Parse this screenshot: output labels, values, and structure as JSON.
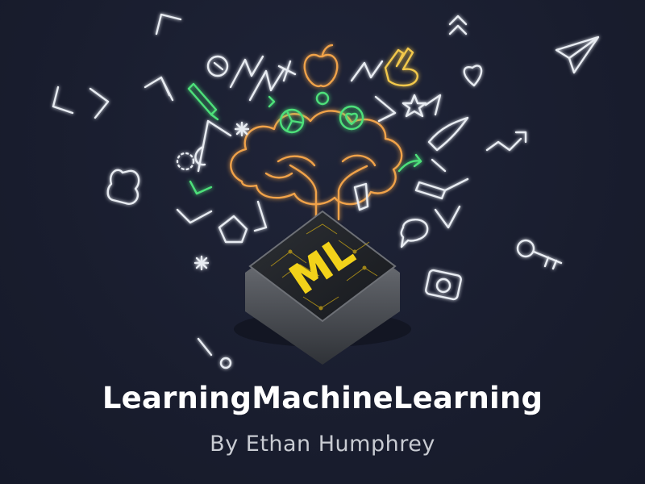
{
  "cover": {
    "title": "LearningMachineLearning",
    "byline": "By Ethan Humphrey",
    "badge_text": "ML"
  },
  "colors": {
    "background": "#191d2e",
    "neon_white": "#e8ecf2",
    "neon_green": "#4ee07a",
    "neon_yellow": "#f2c84b",
    "neon_orange": "#f0a24a",
    "chip_text": "#f2d21a",
    "chip_body": "#5a5d63",
    "title_text": "#ffffff",
    "byline_text": "#c8cbd2"
  },
  "icons": [
    "apple-logo-icon",
    "peace-hand-icon",
    "brain-tree-icon",
    "thumbs-up-hand-icon",
    "paper-plane-icon",
    "heart-icon",
    "key-icon",
    "camera-icon",
    "music-note-icon",
    "lightning-icon",
    "star-icon",
    "exclamation-icon",
    "speech-bubble-icon",
    "bug-icon",
    "bird-icon",
    "arrow-icon",
    "pencil-icon",
    "hammer-icon",
    "propeller-icon",
    "sparkle-icon",
    "chevron-icon",
    "compass-icon"
  ]
}
